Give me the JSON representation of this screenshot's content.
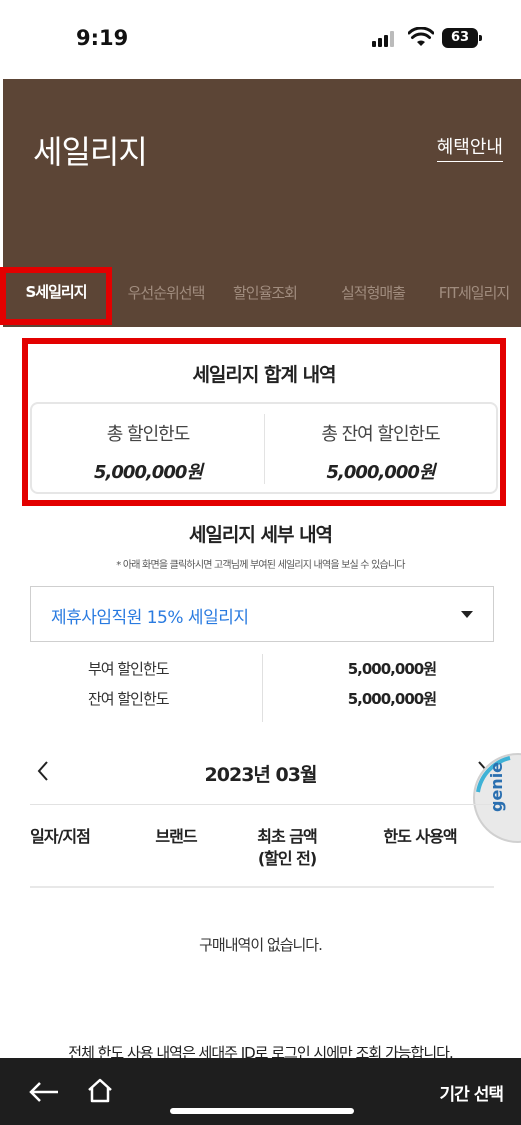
{
  "status": {
    "time": "9:19",
    "battery": "63"
  },
  "header": {
    "title": "세일리지",
    "benefit_link": "혜택안내",
    "tabs": [
      {
        "label": "S세일리지",
        "active": true
      },
      {
        "label": "우선순위선택"
      },
      {
        "label": "할인율조회"
      },
      {
        "label": "실적형매출"
      },
      {
        "label": "FIT세일리지"
      }
    ]
  },
  "summary": {
    "title": "세일리지 합계 내역",
    "total_label": "총 할인한도",
    "total_value": "5,000,000원",
    "remaining_label": "총 잔여 할인한도",
    "remaining_value": "5,000,000원"
  },
  "detail": {
    "title": "세일리지 세부 내역",
    "note": "* 아래 화면을 클릭하시면 고객님께 부여된 세일리지 내역을 보실 수 있습니다",
    "select_value": "제휴사임직원 15% 세일리지",
    "granted_label": "부여 할인한도",
    "granted_value": "5,000,000원",
    "remaining_label": "잔여 할인한도",
    "remaining_value": "5,000,000원"
  },
  "month": {
    "label": "2023년 03월"
  },
  "genie": {
    "label": "genie"
  },
  "table": {
    "headers": [
      "일자/지점",
      "브랜드",
      "최초 금액\n(할인 전)",
      "한도 사용액"
    ],
    "header_line1": "최초 금액",
    "header_line2": "(할인 전)",
    "empty": "구매내역이 없습니다."
  },
  "footer_note": "전체 한도 사용 내역은 세대주 ID로 로그인 시에만 조회 가능합니다.",
  "bottom_bar": {
    "period_button": "기간 선택"
  },
  "colors": {
    "header_bg": "#5c4536",
    "accent_blue": "#2a7be0",
    "highlight_red": "#e30000"
  }
}
